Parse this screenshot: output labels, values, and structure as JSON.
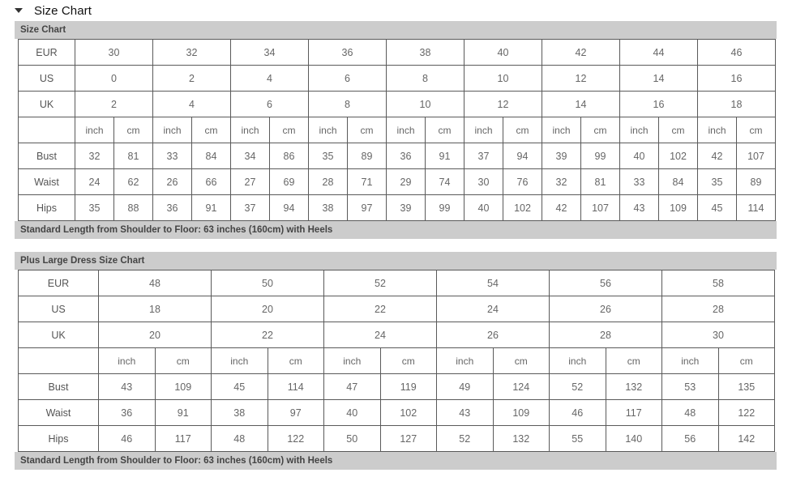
{
  "section": {
    "title": "Size Chart",
    "caret_icon": "caret-down-icon",
    "expanded": true
  },
  "charts": [
    {
      "id": "size-chart",
      "heading": "Size Chart",
      "footer": "Standard Length from Shoulder to Floor: 63 inches (160cm) with Heels",
      "row_labels": {
        "eur": "EUR",
        "us": "US",
        "uk": "UK",
        "units": "",
        "bust": "Bust",
        "waist": "Waist",
        "hips": "Hips"
      },
      "units": {
        "inch": "inch",
        "cm": "cm"
      },
      "eur": [
        "30",
        "32",
        "34",
        "36",
        "38",
        "40",
        "42",
        "44",
        "46"
      ],
      "us": [
        "0",
        "2",
        "4",
        "6",
        "8",
        "10",
        "12",
        "14",
        "16"
      ],
      "uk": [
        "2",
        "4",
        "6",
        "8",
        "10",
        "12",
        "14",
        "16",
        "18"
      ],
      "bust_inch": [
        "32",
        "33",
        "34",
        "35",
        "36",
        "37",
        "39",
        "40",
        "42"
      ],
      "bust_cm": [
        "81",
        "84",
        "86",
        "89",
        "91",
        "94",
        "99",
        "102",
        "107"
      ],
      "waist_inch": [
        "24",
        "26",
        "27",
        "28",
        "29",
        "30",
        "32",
        "33",
        "35"
      ],
      "waist_cm": [
        "62",
        "66",
        "69",
        "71",
        "74",
        "76",
        "81",
        "84",
        "89"
      ],
      "hips_inch": [
        "35",
        "36",
        "37",
        "38",
        "39",
        "40",
        "42",
        "43",
        "45"
      ],
      "hips_cm": [
        "88",
        "91",
        "94",
        "97",
        "99",
        "102",
        "107",
        "109",
        "114"
      ]
    },
    {
      "id": "plus-size-chart",
      "heading": "Plus Large Dress Size Chart",
      "footer": "Standard Length from Shoulder to Floor: 63 inches (160cm) with Heels",
      "row_labels": {
        "eur": "EUR",
        "us": "US",
        "uk": "UK",
        "units": "",
        "bust": "Bust",
        "waist": "Waist",
        "hips": "Hips"
      },
      "units": {
        "inch": "inch",
        "cm": "cm"
      },
      "eur": [
        "48",
        "50",
        "52",
        "54",
        "56",
        "58"
      ],
      "us": [
        "18",
        "20",
        "22",
        "24",
        "26",
        "28"
      ],
      "uk": [
        "20",
        "22",
        "24",
        "26",
        "28",
        "30"
      ],
      "bust_inch": [
        "43",
        "45",
        "47",
        "49",
        "52",
        "53"
      ],
      "bust_cm": [
        "109",
        "114",
        "119",
        "124",
        "132",
        "135"
      ],
      "waist_inch": [
        "36",
        "38",
        "40",
        "43",
        "46",
        "48"
      ],
      "waist_cm": [
        "91",
        "97",
        "102",
        "109",
        "117",
        "122"
      ],
      "hips_inch": [
        "46",
        "48",
        "50",
        "52",
        "55",
        "56"
      ],
      "hips_cm": [
        "117",
        "122",
        "127",
        "132",
        "140",
        "142"
      ]
    }
  ],
  "colors": {
    "bar_bg": "#cccccc",
    "bar_text": "#444444",
    "cell_text": "#666666",
    "border": "#5a5a5a",
    "title_text": "#111111"
  }
}
